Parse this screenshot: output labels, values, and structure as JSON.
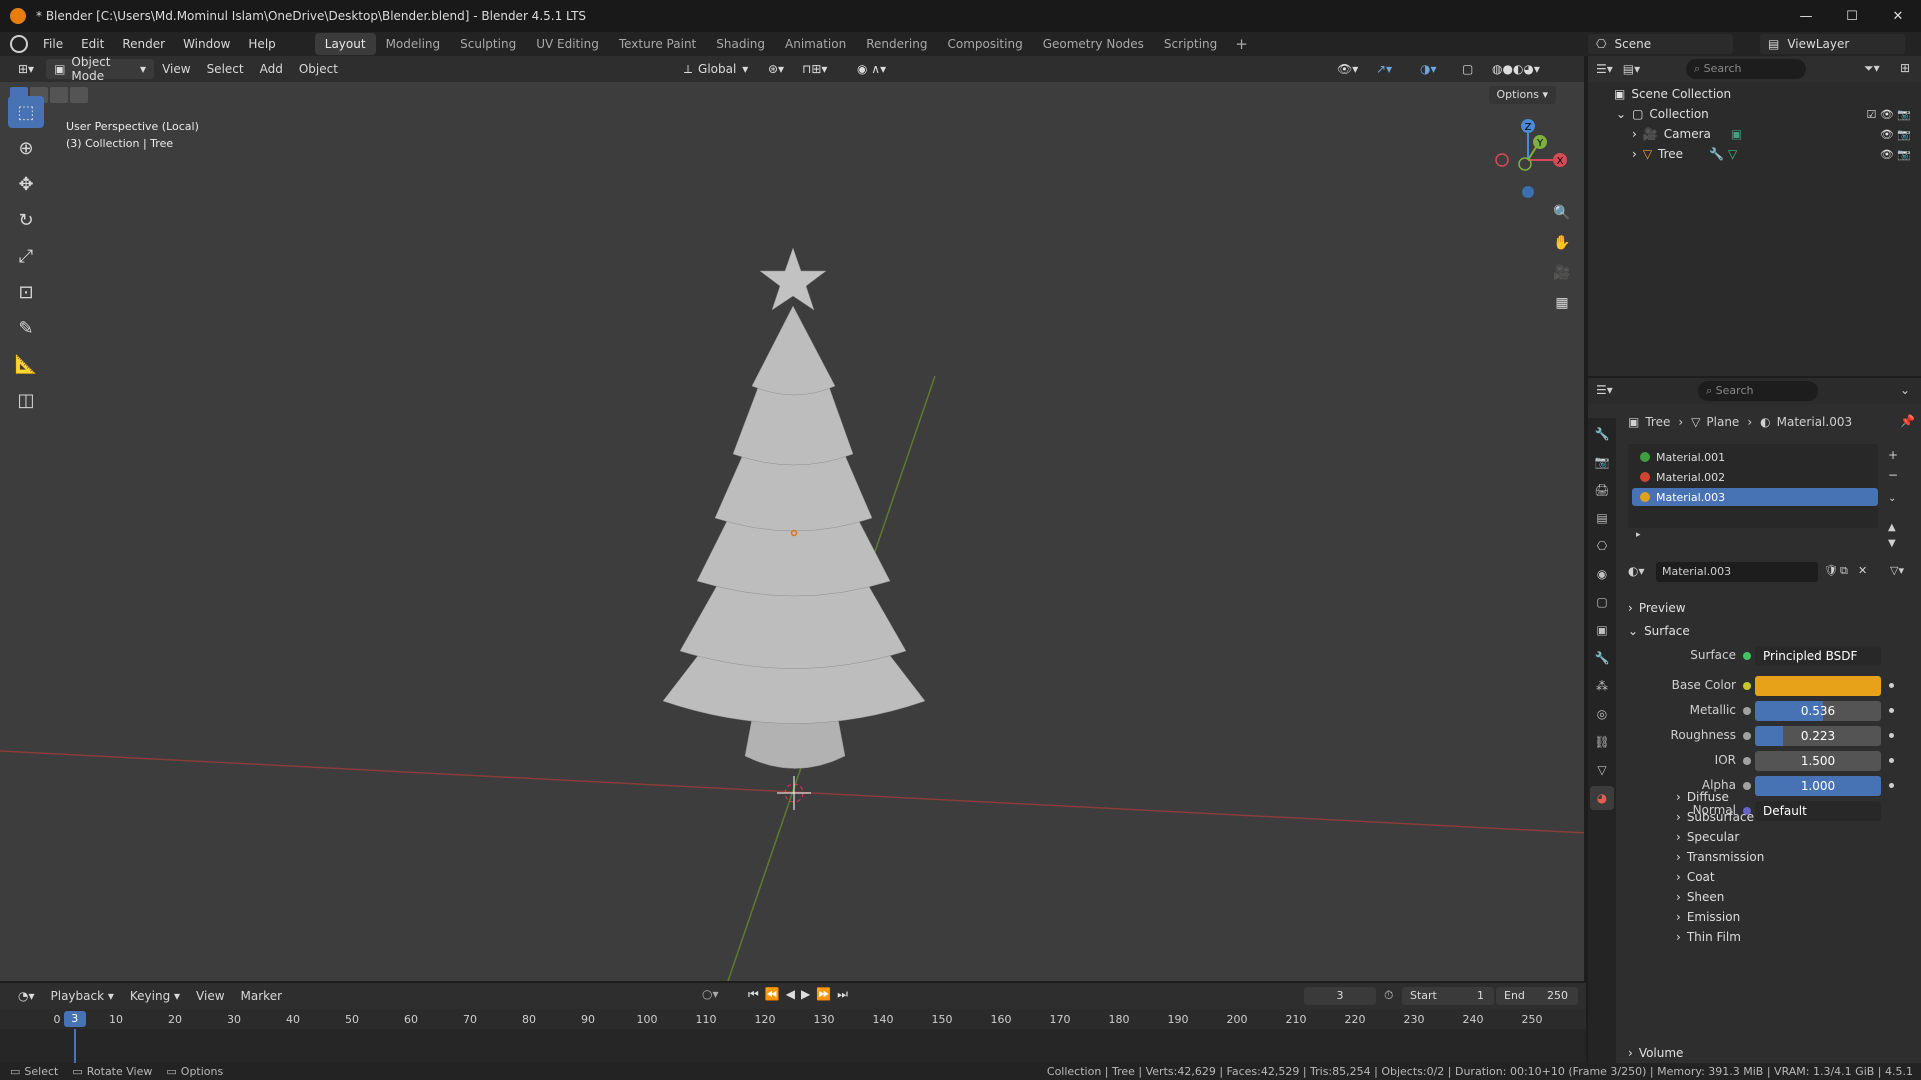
{
  "titlebar": {
    "title": "* Blender [C:\\Users\\Md.Mominul Islam\\OneDrive\\Desktop\\Blender.blend] - Blender 4.5.1 LTS"
  },
  "menus": [
    "File",
    "Edit",
    "Render",
    "Window",
    "Help"
  ],
  "workspaces": [
    "Layout",
    "Modeling",
    "Sculpting",
    "UV Editing",
    "Texture Paint",
    "Shading",
    "Animation",
    "Rendering",
    "Compositing",
    "Geometry Nodes",
    "Scripting"
  ],
  "active_workspace": "Layout",
  "scene": {
    "scene_name": "Scene",
    "view_layer": "ViewLayer"
  },
  "viewport": {
    "mode": "Object Mode",
    "menus": [
      "View",
      "Select",
      "Add",
      "Object"
    ],
    "transform_orientation": "Global",
    "options_label": "Options",
    "overlay_line1": "User Perspective (Local)",
    "overlay_line2": "(3) Collection | Tree",
    "gizmo_axes": {
      "x": "X",
      "y": "Y",
      "z": "Z"
    }
  },
  "timeline": {
    "menus": [
      "Playback",
      "Keying",
      "View",
      "Marker"
    ],
    "current_frame": "3",
    "start_label": "Start",
    "start": "1",
    "end_label": "End",
    "end": "250",
    "ticks": [
      "0",
      "10",
      "20",
      "30",
      "40",
      "50",
      "60",
      "70",
      "80",
      "90",
      "100",
      "110",
      "120",
      "130",
      "140",
      "150",
      "160",
      "170",
      "180",
      "190",
      "200",
      "210",
      "220",
      "230",
      "240",
      "250"
    ]
  },
  "statusbar": {
    "left": [
      "Select",
      "Rotate View",
      "Options"
    ],
    "right": "Collection | Tree | Verts:42,629 | Faces:42,529 | Tris:85,254 | Objects:0/2 | Duration: 00:10+10 (Frame 3/250) | Memory: 391.3 MiB | VRAM: 1.3/4.1 GiB | 4.5.1"
  },
  "outliner": {
    "search_placeholder": "Search",
    "scene_collection": "Scene Collection",
    "collection": "Collection",
    "items": [
      "Camera",
      "Tree"
    ]
  },
  "properties": {
    "search_placeholder": "Search",
    "breadcrumb": [
      "Tree",
      "Plane",
      "Material.003"
    ],
    "slots": [
      {
        "name": "Material.001",
        "color": "#3fa03f"
      },
      {
        "name": "Material.002",
        "color": "#d0452f"
      },
      {
        "name": "Material.003",
        "color": "#e0a020"
      }
    ],
    "active_material": "Material.003",
    "panels": {
      "preview": "Preview",
      "surface": "Surface"
    },
    "surface_label": "Surface",
    "surface_shader": "Principled BSDF",
    "rows": [
      {
        "label": "Base Color",
        "value": "",
        "kind": "color",
        "color": "#e8a21a",
        "sock": "#c7c729"
      },
      {
        "label": "Metallic",
        "value": "0.536",
        "kind": "slider",
        "fill": 0.536,
        "sock": "#a1a1a1"
      },
      {
        "label": "Roughness",
        "value": "0.223",
        "kind": "slider",
        "fill": 0.223,
        "sock": "#a1a1a1"
      },
      {
        "label": "IOR",
        "value": "1.500",
        "kind": "number",
        "fill": 0,
        "sock": "#a1a1a1"
      },
      {
        "label": "Alpha",
        "value": "1.000",
        "kind": "slider",
        "fill": 1.0,
        "sock": "#a1a1a1"
      },
      {
        "label": "Normal",
        "value": "Default",
        "kind": "text",
        "sock": "#6363c7"
      }
    ],
    "subpanels": [
      "Diffuse",
      "Subsurface",
      "Specular",
      "Transmission",
      "Coat",
      "Sheen",
      "Emission",
      "Thin Film"
    ],
    "volume": "Volume"
  },
  "colors": {
    "accent": "#4772b3",
    "brand": "#e87d0d"
  }
}
